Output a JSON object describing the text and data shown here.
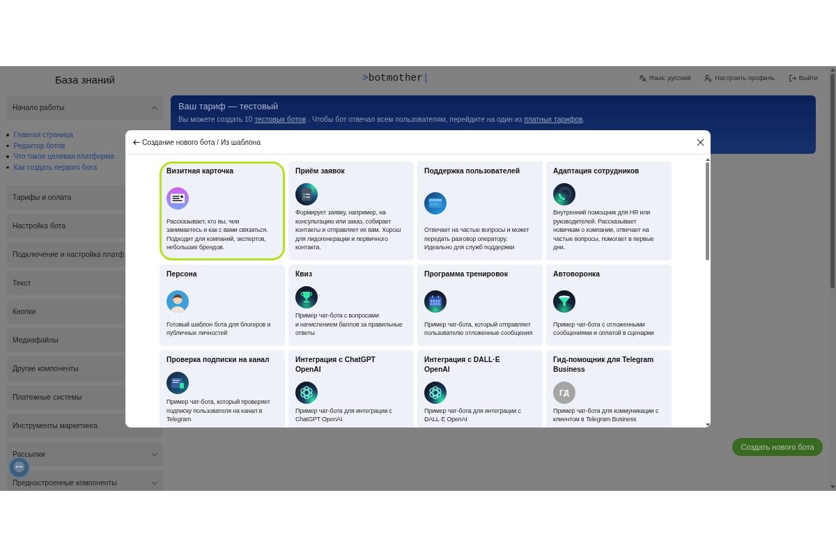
{
  "sidebar": {
    "title": "База знаний",
    "items": [
      {
        "label": "Начало работы",
        "kind": "group",
        "expanded": true,
        "children": [
          {
            "label": "Главная страница"
          },
          {
            "label": "Редактор ботов"
          },
          {
            "label": "Что такое целевая платформа"
          },
          {
            "label": "Как создать первого бота"
          }
        ]
      },
      {
        "label": "Тарифы и оплата",
        "kind": "page"
      },
      {
        "label": "Настройка бота",
        "kind": "page"
      },
      {
        "label": "Подключение и настройка платф",
        "kind": "page"
      },
      {
        "label": "Текст",
        "kind": "page"
      },
      {
        "label": "Кнопки",
        "kind": "page"
      },
      {
        "label": "Медиафайлы",
        "kind": "page"
      },
      {
        "label": "Другие компоненты",
        "kind": "page"
      },
      {
        "label": "Платежные системы",
        "kind": "page"
      },
      {
        "label": "Инструменты маркетинга",
        "kind": "page"
      },
      {
        "label": "Рассылки",
        "kind": "group",
        "expanded": false
      },
      {
        "label": "Преднастроенные компоненты",
        "kind": "group",
        "expanded": false
      }
    ]
  },
  "header": {
    "logo": {
      "mark": ">",
      "text": "botmother",
      "cursor": "|"
    },
    "nav": [
      {
        "label": "Язык: русский"
      },
      {
        "label": "Настроить профиль"
      },
      {
        "label": "Выйти"
      }
    ]
  },
  "banner": {
    "title": "Ваш тариф — тестовый",
    "notice": [
      {
        "text": "Вы можете создать 10 ",
        "link": false
      },
      {
        "text": "тестовых ботов",
        "link": true
      },
      {
        "text": " . Чтобы бот отвечал всем пользователям, перейдите на один из ",
        "link": false
      },
      {
        "text": "платных тарифов",
        "link": true
      },
      {
        "text": ".",
        "link": false
      }
    ]
  },
  "create_button": "Создать нового бота",
  "modal": {
    "title": "Создание нового бота / Из шаблона",
    "templates": [
      {
        "title": "Визитная карточка",
        "description": "Рассказывает, кто вы, чем\nзанимаетесь и как с вами связаться.\nПодходит для компаний, экспертов,\nнебольших брендов.",
        "selected": true
      },
      {
        "title": "Приём заявок",
        "description": "Формирует заявку, например, на\nконсультацию или заказ, собирает\nконтакты и отправляет их вам. Хорош\nдля лидогенерации и первичного\nконтакта.",
        "selected": false
      },
      {
        "title": "Поддержка пользователей",
        "description": "Отвечает на частые вопросы и может\nпередать разговор оператору.\nИдеально для служб поддержки",
        "selected": false
      },
      {
        "title": "Адаптация сотрудников",
        "description": "Внутренний помощник для HR или\nруководителей. Рассказывает\nновичкам о компании, отвечает на\nчастые вопросы, помогает в первые\nдни.",
        "selected": false
      },
      {
        "title": "Персона",
        "description": "Готовый шаблон бота для блогеров и\nпубличных личностей",
        "selected": false
      },
      {
        "title": "Квиз",
        "description": "Пример чат-бота с вопросами\nи начислением баллов за правильные\nответы",
        "selected": false
      },
      {
        "title": "Программа тренировок",
        "description": "Пример чат-бота, который отправляет\nпользователю отложенные сообщения",
        "selected": false
      },
      {
        "title": "Автоворонка",
        "description": "Пример чат-бота с отложенными\nсообщениями и оплатой в сценарии",
        "selected": false
      },
      {
        "title": "Проверка подписки на канал",
        "description": "Пример чат-бота, который проверяет\nподписку пользователя на канал в\nTelegram",
        "selected": false
      },
      {
        "title": "Интеграция с ChatGPT\nOpenAI",
        "description": "Пример чат-бота для интеграции с\nChatGPT OpenAI",
        "selected": false
      },
      {
        "title": "Интеграция с DALL·E\nOpenAI",
        "description": "Пример чат-бота для интеграции с\nDALL·E OpenAI",
        "selected": false
      },
      {
        "title": "Гид-помощник для Telegram\nBusiness",
        "initials": "ГД",
        "description": "Пример чат-бота для коммуникации с\nклиентом в Telegram Business",
        "selected": false
      }
    ]
  }
}
